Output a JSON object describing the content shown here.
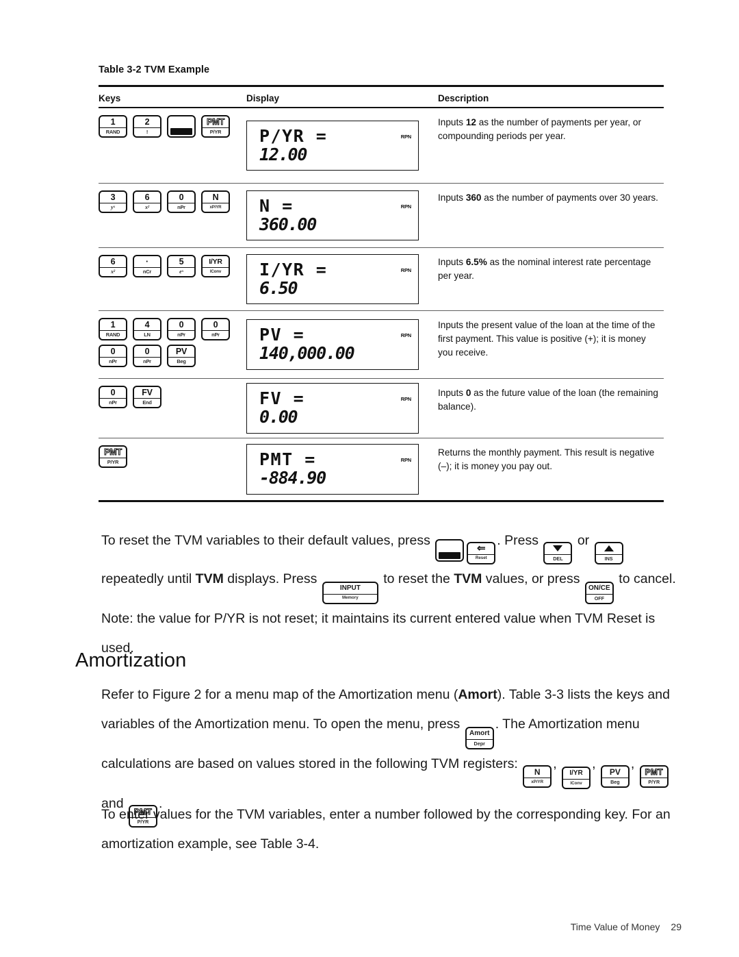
{
  "table": {
    "caption": "Table 3-2  TVM Example",
    "headers": [
      "Keys",
      "Display",
      "Description"
    ],
    "rows": [
      {
        "keys": [
          [
            {
              "top": "1",
              "bot": "RAND"
            },
            {
              "top": "2",
              "bot": "!"
            },
            {
              "top": "",
              "bot": "blackbar"
            },
            {
              "top": "PMT",
              "bot": "P/YR"
            }
          ]
        ],
        "display_label": "P/YR =",
        "display_value": "12.00",
        "annunciator": "RPN",
        "description_parts": [
          {
            "text": "Inputs ",
            "bold": false
          },
          {
            "text": "12",
            "bold": true
          },
          {
            "text": " as the number of payments per year, or compounding periods per year.",
            "bold": false
          }
        ]
      },
      {
        "keys": [
          [
            {
              "top": "3",
              "bot": "yˣ"
            },
            {
              "top": "6",
              "bot": "x²"
            },
            {
              "top": "0",
              "bot": "nPr"
            },
            {
              "top": "N",
              "bot": "xP/YR"
            }
          ]
        ],
        "display_label": "N =",
        "display_value": "360.00",
        "annunciator": "RPN",
        "description_parts": [
          {
            "text": "Inputs ",
            "bold": false
          },
          {
            "text": "360",
            "bold": true
          },
          {
            "text": " as the number of payments over 30 years.",
            "bold": false
          }
        ]
      },
      {
        "keys": [
          [
            {
              "top": "6",
              "bot": "x²"
            },
            {
              "top": "·",
              "bot": "nCr"
            },
            {
              "top": "5",
              "bot": "eˣ"
            },
            {
              "top": "I/YR",
              "bot": "IConv"
            }
          ]
        ],
        "display_label": "I/YR =",
        "display_value": "6.50",
        "annunciator": "RPN",
        "description_parts": [
          {
            "text": "Inputs ",
            "bold": false
          },
          {
            "text": "6.5%",
            "bold": true
          },
          {
            "text": " as the nominal interest rate percentage per year.",
            "bold": false
          }
        ]
      },
      {
        "keys": [
          [
            {
              "top": "1",
              "bot": "RAND"
            },
            {
              "top": "4",
              "bot": "LN"
            },
            {
              "top": "0",
              "bot": "nPr"
            },
            {
              "top": "0",
              "bot": "nPr"
            }
          ],
          [
            {
              "top": "0",
              "bot": "nPr"
            },
            {
              "top": "0",
              "bot": "nPr"
            },
            {
              "top": "PV",
              "bot": "Beg"
            }
          ]
        ],
        "display_label": "PV =",
        "display_value": "140,000.00",
        "annunciator": "RPN",
        "description_parts": [
          {
            "text": "Inputs the present value of the loan at the time of the first payment. This value is positive (+); it is money you receive.",
            "bold": false
          }
        ]
      },
      {
        "keys": [
          [
            {
              "top": "0",
              "bot": "nPr"
            },
            {
              "top": "FV",
              "bot": "End"
            }
          ]
        ],
        "display_label": "FV =",
        "display_value": "0.00",
        "annunciator": "RPN",
        "description_parts": [
          {
            "text": "Inputs ",
            "bold": false
          },
          {
            "text": "0",
            "bold": true
          },
          {
            "text": " as the future value of the loan (the remaining balance).",
            "bold": false
          }
        ]
      },
      {
        "keys": [
          [
            {
              "top": "PMT",
              "bot": "P/YR"
            }
          ]
        ],
        "display_label": "PMT =",
        "display_value": "-884.90",
        "annunciator": "RPN",
        "description_parts": [
          {
            "text": "Returns the monthly payment. This result is negative (–); it is money you pay out.",
            "bold": false
          }
        ]
      }
    ]
  },
  "paragraphs": {
    "reset": {
      "t1": "To reset the TVM variables to their default values, press ",
      "t2": ". Press ",
      "t3": " or ",
      "t4": " repeatedly until ",
      "t5": "TVM",
      "t6": " displays. Press ",
      "t7": " to reset the ",
      "t8": "TVM",
      "t9": " values, or press ",
      "t10": " to cancel. Note: the value for P/YR is not reset; it maintains its current entered value when TVM Reset is used."
    },
    "amort_heading": "Amortization",
    "amort1": {
      "t1": "Refer to Figure 2 for a menu map of the Amortization menu (",
      "t2": "Amort",
      "t3": "). Table 3-3 lists the keys and variables of the Amortization menu. To open the menu, press ",
      "t4": ". The Amortization menu calculations are based on values stored in the following TVM registers: ",
      "t5": ", ",
      "t6": ", ",
      "t7": ", ",
      "t8": " and ",
      "t9": "."
    },
    "amort2": "To enter values for the TVM variables, enter a number followed by the corresponding key. For an amortization example, see Table 3-4."
  },
  "inline_keys": {
    "shift": {
      "top": "",
      "bot": "blackbar"
    },
    "reset": {
      "top": "⇐",
      "bot": "Reset"
    },
    "del": {
      "top": "▼",
      "bot": "DEL"
    },
    "ins": {
      "top": "▲",
      "bot": "INS"
    },
    "input": {
      "top": "INPUT",
      "bot": "Memory"
    },
    "onoff": {
      "top": "ON/CE",
      "bot": "OFF"
    },
    "amort": {
      "top": "Amort",
      "bot": "Depr"
    },
    "n": {
      "top": "N",
      "bot": "xP/YR"
    },
    "iyr": {
      "top": "I/YR",
      "bot": "IConv"
    },
    "pv": {
      "top": "PV",
      "bot": "Beg"
    },
    "pmt": {
      "top": "PMT",
      "bot": "P/YR"
    },
    "pmt_shift": {
      "top": "PMT",
      "bot": "P/YR"
    }
  },
  "footer": {
    "section": "Time Value of Money",
    "page": "29"
  }
}
